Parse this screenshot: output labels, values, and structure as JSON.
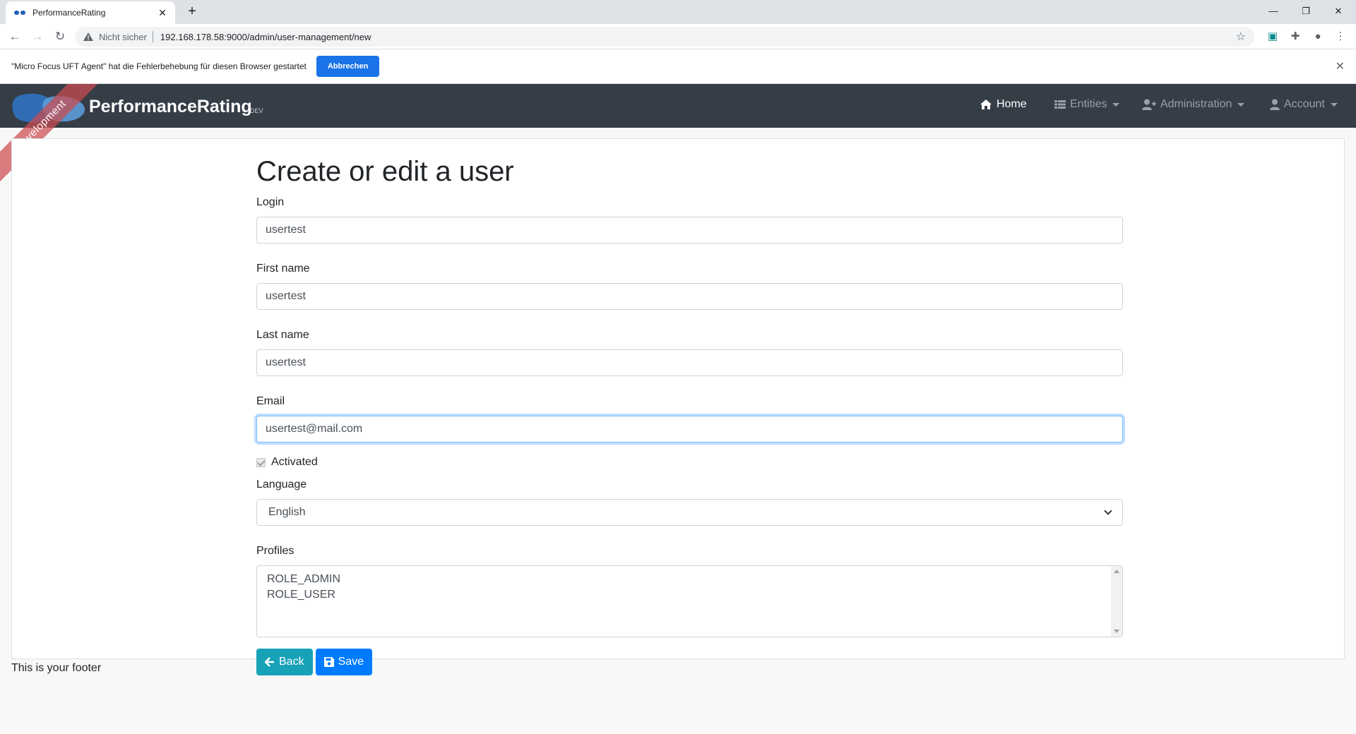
{
  "browser": {
    "tab_title": "PerformanceRating",
    "not_secure": "Nicht sicher",
    "url": "192.168.178.58:9000/admin/user-management/new",
    "infobar_text": "\"Micro Focus UFT Agent\" hat die Fehlerbehebung für diesen Browser gestartet",
    "infobar_button": "Abbrechen"
  },
  "navbar": {
    "brand": "PerformanceRating",
    "brand_tag": "DEV",
    "ribbon": "Development",
    "items": [
      {
        "label": "Home",
        "icon": "home-icon"
      },
      {
        "label": "Entities",
        "icon": "list-icon"
      },
      {
        "label": "Administration",
        "icon": "user-plus-icon"
      },
      {
        "label": "Account",
        "icon": "user-icon"
      }
    ]
  },
  "form": {
    "title": "Create or edit a user",
    "login_label": "Login",
    "login_value": "usertest",
    "first_name_label": "First name",
    "first_name_value": "usertest",
    "last_name_label": "Last name",
    "last_name_value": "usertest",
    "email_label": "Email",
    "email_value": "usertest@mail.com",
    "activated_label": "Activated",
    "language_label": "Language",
    "language_value": "English",
    "profiles_label": "Profiles",
    "profiles": [
      "ROLE_ADMIN",
      "ROLE_USER"
    ],
    "back_label": "Back",
    "save_label": "Save"
  },
  "footer": {
    "text": "This is your footer"
  },
  "colors": {
    "navbar": "#353d47",
    "back_button": "#17a2b8",
    "save_button": "#007bff",
    "ribbon": "#cd4b50"
  }
}
